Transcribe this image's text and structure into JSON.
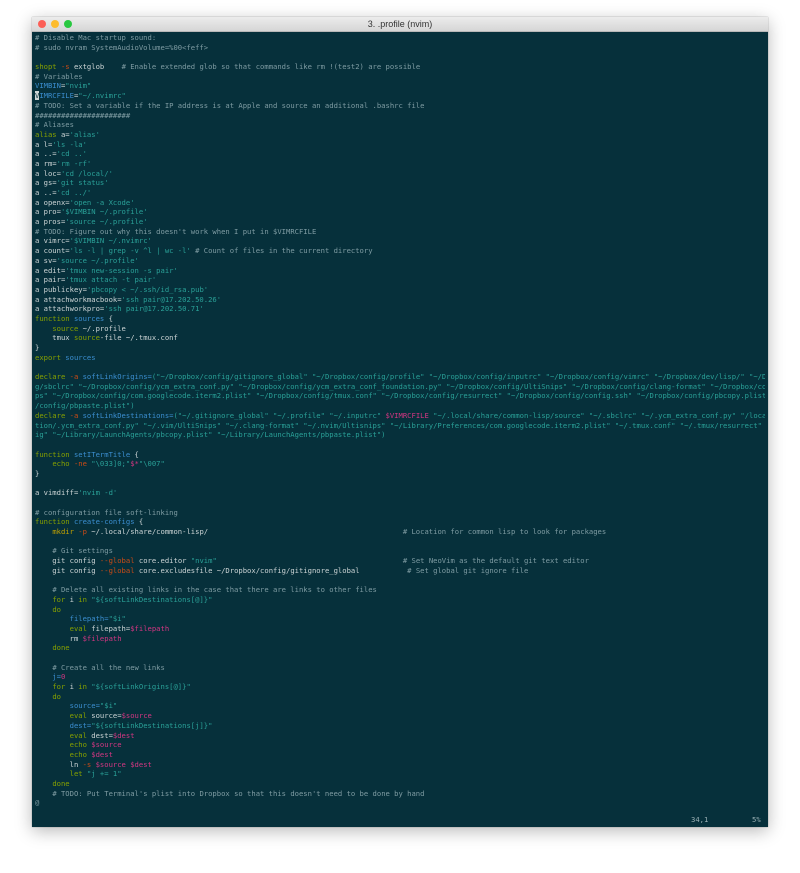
{
  "window": {
    "title": "3. .profile (nvim)"
  },
  "colors": {
    "background": "#06303b",
    "comment": "#7f9ca3",
    "keyword": "#86a000",
    "builtin": "#3b8ed0",
    "string": "#2aa198",
    "variable": "#d33682",
    "command": "#c2a200",
    "orange": "#cb4b16",
    "text": "#cdd5d6"
  },
  "editor": {
    "lines": [
      [
        [
          "# Disable Mac startup sound:",
          "cm"
        ]
      ],
      [
        [
          "# sudo nvram SystemAudioVolume=%00<feff>",
          "cm"
        ]
      ],
      [],
      [
        [
          "shopt",
          "kw"
        ],
        [
          " ",
          "tx"
        ],
        [
          "-s",
          "or"
        ],
        [
          " extglob    ",
          "tx"
        ],
        [
          "# Enable extended glob so that commands like rm !(test2) are possible",
          "cm"
        ]
      ],
      [
        [
          "# Variables",
          "cm"
        ]
      ],
      [
        [
          "VIMBIN",
          "bl"
        ],
        [
          "=",
          "tx"
        ],
        [
          "\"nvim\"",
          "st"
        ]
      ],
      [
        [
          "V",
          "cur"
        ],
        [
          "IMRCFILE",
          "bl"
        ],
        [
          "=",
          "tx"
        ],
        [
          "\"~/.nvimrc\"",
          "st"
        ]
      ],
      [
        [
          "# ",
          "cm"
        ],
        [
          "TODO:",
          "cm"
        ],
        [
          " Set a variable if the IP address is at Apple and source an additional .bashrc file",
          "cm"
        ]
      ],
      [
        [
          "######################",
          "cm"
        ]
      ],
      [
        [
          "# Aliases",
          "cm"
        ]
      ],
      [
        [
          "alias",
          "kw"
        ],
        [
          " a=",
          "tx"
        ],
        [
          "'alias'",
          "st"
        ]
      ],
      [
        [
          "a",
          "tx"
        ],
        [
          " l=",
          "tx"
        ],
        [
          "'ls -la'",
          "st"
        ]
      ],
      [
        [
          "a",
          "tx"
        ],
        [
          " ..=",
          "tx"
        ],
        [
          "'cd ..'",
          "st"
        ]
      ],
      [
        [
          "a",
          "tx"
        ],
        [
          " rm=",
          "tx"
        ],
        [
          "'rm -rf'",
          "st"
        ]
      ],
      [
        [
          "a",
          "tx"
        ],
        [
          " loc=",
          "tx"
        ],
        [
          "'cd /local/'",
          "st"
        ]
      ],
      [
        [
          "a",
          "tx"
        ],
        [
          " gs=",
          "tx"
        ],
        [
          "'git status'",
          "st"
        ]
      ],
      [
        [
          "a",
          "tx"
        ],
        [
          " ..=",
          "tx"
        ],
        [
          "'cd ../'",
          "st"
        ]
      ],
      [
        [
          "a",
          "tx"
        ],
        [
          " openx=",
          "tx"
        ],
        [
          "'open -a Xcode'",
          "st"
        ]
      ],
      [
        [
          "a",
          "tx"
        ],
        [
          " pro=",
          "tx"
        ],
        [
          "'$VIMBIN ~/.profile'",
          "st"
        ]
      ],
      [
        [
          "a",
          "tx"
        ],
        [
          " pros=",
          "tx"
        ],
        [
          "'source ~/.profile'",
          "st"
        ]
      ],
      [
        [
          "# ",
          "cm"
        ],
        [
          "TODO:",
          "cm"
        ],
        [
          " Figure out why this doesn't work when I put in $VIMRCFILE",
          "cm"
        ]
      ],
      [
        [
          "a",
          "tx"
        ],
        [
          " vimrc=",
          "tx"
        ],
        [
          "'$VIMBIN ~/.nvimrc'",
          "st"
        ]
      ],
      [
        [
          "a",
          "tx"
        ],
        [
          " count=",
          "tx"
        ],
        [
          "'ls -l | grep -v ^l | wc -l'",
          "st"
        ],
        [
          " ",
          "tx"
        ],
        [
          "# Count of files in the current directory",
          "cm"
        ]
      ],
      [
        [
          "a",
          "tx"
        ],
        [
          " sv=",
          "tx"
        ],
        [
          "'source ~/.profile'",
          "st"
        ]
      ],
      [
        [
          "a",
          "tx"
        ],
        [
          " edit=",
          "tx"
        ],
        [
          "'tmux new-session -s pair'",
          "st"
        ]
      ],
      [
        [
          "a",
          "tx"
        ],
        [
          " pair=",
          "tx"
        ],
        [
          "'tmux attach -t pair'",
          "st"
        ]
      ],
      [
        [
          "a",
          "tx"
        ],
        [
          " publickey=",
          "tx"
        ],
        [
          "'pbcopy < ~/.ssh/id_rsa.pub'",
          "st"
        ]
      ],
      [
        [
          "a",
          "tx"
        ],
        [
          " attachworkmacbook=",
          "tx"
        ],
        [
          "'ssh pair@17.202.50.26'",
          "st"
        ]
      ],
      [
        [
          "a",
          "tx"
        ],
        [
          " attachworkpro=",
          "tx"
        ],
        [
          "'ssh pair@17.202.50.71'",
          "st"
        ]
      ],
      [
        [
          "function",
          "kw"
        ],
        [
          " ",
          "tx"
        ],
        [
          "sources",
          "bl"
        ],
        [
          " {",
          "tx"
        ]
      ],
      [
        [
          "    ",
          "tx"
        ],
        [
          "source",
          "kw"
        ],
        [
          " ~/.profile",
          "tx"
        ]
      ],
      [
        [
          "    tmux ",
          "tx"
        ],
        [
          "source",
          "kw"
        ],
        [
          "-file ~/.tmux.conf",
          "tx"
        ]
      ],
      [
        [
          "}",
          "tx"
        ]
      ],
      [
        [
          "export",
          "kw"
        ],
        [
          " ",
          "tx"
        ],
        [
          "sources",
          "bl"
        ]
      ],
      [],
      [
        [
          "declare",
          "kw"
        ],
        [
          " ",
          "tx"
        ],
        [
          "-a",
          "or"
        ],
        [
          " softLinkOrigins=",
          "bl"
        ],
        [
          "(\"~/Dropbox/config/gitignore_global\" \"~/Dropbox/config/profile\" \"~/Dropbox/config/inputrc\" \"~/Dropbox/config/vimrc\" \"~/Dropbox/dev/lisp/\" \"~/Dropbox/confi",
          "st"
        ]
      ],
      [
        [
          "g/sbclrc\" \"~/Dropbox/config/ycm_extra_conf.py\" \"~/Dropbox/config/ycm_extra_conf_foundation.py\" \"~/Dropbox/config/UltiSnips\" \"~/Dropbox/config/clang-format\" \"~/Dropbox/config/UltiSnip",
          "st"
        ]
      ],
      [
        [
          "ps\" \"~/Dropbox/config/com.googlecode.iterm2.plist\" \"~/Dropbox/config/tmux.conf\" \"~/Dropbox/config/resurrect\" \"~/Dropbox/config/config.ssh\" \"~/Dropbox/config/pbcopy.plist\" \"~/Dropbox",
          "st"
        ]
      ],
      [
        [
          "/config/pbpaste.plist\")",
          "st"
        ]
      ],
      [
        [
          "declare",
          "kw"
        ],
        [
          " ",
          "tx"
        ],
        [
          "-a",
          "or"
        ],
        [
          " softLinkDestinations=",
          "bl"
        ],
        [
          "(\"~/.gitignore_global\" \"~/.profile\" \"~/.inputrc\" ",
          "st"
        ],
        [
          "$VIMRCFILE",
          "mg"
        ],
        [
          " \"~/.local/share/common-lisp/source\" \"~/.sbclrc\" \"~/.ycm_extra_conf.py\" \"/local/dev/Founda",
          "st"
        ]
      ],
      [
        [
          "tion/.ycm_extra_conf.py\" \"~/.vim/UltiSnips\" \"~/.clang-format\" \"~/.nvim/Ultisnips\" \"~/Library/Preferences/com.googlecode.iterm2.plist\" \"~/.tmux.conf\" \"~/.tmux/resurrect\" \"~/.ssh/conf",
          "st"
        ]
      ],
      [
        [
          "ig\" \"~/Library/LaunchAgents/pbcopy.plist\" \"~/Library/LaunchAgents/pbpaste.plist\")",
          "st"
        ]
      ],
      [],
      [
        [
          "function",
          "kw"
        ],
        [
          " ",
          "tx"
        ],
        [
          "setITermTitle",
          "bl"
        ],
        [
          " {",
          "tx"
        ]
      ],
      [
        [
          "    ",
          "tx"
        ],
        [
          "echo",
          "kw"
        ],
        [
          " ",
          "tx"
        ],
        [
          "-ne",
          "or"
        ],
        [
          " ",
          "tx"
        ],
        [
          "\"\\033]0;\"",
          "st"
        ],
        [
          "$*",
          "mg"
        ],
        [
          "\"\\007\"",
          "st"
        ]
      ],
      [
        [
          "}",
          "tx"
        ]
      ],
      [],
      [
        [
          "a",
          "tx"
        ],
        [
          " vimdiff=",
          "tx"
        ],
        [
          "'nvim -d'",
          "st"
        ]
      ],
      [],
      [
        [
          "# configuration file soft-linking",
          "cm"
        ]
      ],
      [
        [
          "function",
          "kw"
        ],
        [
          " ",
          "tx"
        ],
        [
          "create-configs",
          "bl"
        ],
        [
          " {",
          "tx"
        ]
      ],
      [
        [
          "    ",
          "tx"
        ],
        [
          "mkdir",
          "yl"
        ],
        [
          " ",
          "tx"
        ],
        [
          "-p",
          "or"
        ],
        [
          " ~/.local/share/common-lisp/                                             ",
          "tx"
        ],
        [
          "# Location for common lisp to look for packages",
          "cm"
        ]
      ],
      [],
      [
        [
          "    ",
          "tx"
        ],
        [
          "# Git settings",
          "cm"
        ]
      ],
      [
        [
          "    git config ",
          "tx"
        ],
        [
          "--global",
          "or"
        ],
        [
          " core.editor ",
          "tx"
        ],
        [
          "\"nvim\"",
          "st"
        ],
        [
          "                                           ",
          "tx"
        ],
        [
          "# Set NeoVim as the default git text editor",
          "cm"
        ]
      ],
      [
        [
          "    git config ",
          "tx"
        ],
        [
          "--global",
          "or"
        ],
        [
          " core.excludesfile ~/Dropbox/config/gitignore_global           ",
          "tx"
        ],
        [
          "# Set global git ignore file",
          "cm"
        ]
      ],
      [],
      [
        [
          "    ",
          "tx"
        ],
        [
          "# Delete all existing links in the case that there are links to other files",
          "cm"
        ]
      ],
      [
        [
          "    ",
          "tx"
        ],
        [
          "for",
          "kw"
        ],
        [
          " i ",
          "tx"
        ],
        [
          "in",
          "kw"
        ],
        [
          " ",
          "tx"
        ],
        [
          "\"${softLinkDestinations[@]}\"",
          "st"
        ]
      ],
      [
        [
          "    ",
          "tx"
        ],
        [
          "do",
          "kw"
        ]
      ],
      [
        [
          "        filepath=",
          "bl"
        ],
        [
          "\"$i\"",
          "st"
        ]
      ],
      [
        [
          "        ",
          "tx"
        ],
        [
          "eval",
          "kw"
        ],
        [
          " filepath=",
          "tx"
        ],
        [
          "$filepath",
          "mg"
        ]
      ],
      [
        [
          "        rm ",
          "tx"
        ],
        [
          "$filepath",
          "mg"
        ]
      ],
      [
        [
          "    ",
          "tx"
        ],
        [
          "done",
          "kw"
        ]
      ],
      [],
      [
        [
          "    ",
          "tx"
        ],
        [
          "# Create all the new links",
          "cm"
        ]
      ],
      [
        [
          "    j=",
          "bl"
        ],
        [
          "0",
          "mg"
        ]
      ],
      [
        [
          "    ",
          "tx"
        ],
        [
          "for",
          "kw"
        ],
        [
          " i ",
          "tx"
        ],
        [
          "in",
          "kw"
        ],
        [
          " ",
          "tx"
        ],
        [
          "\"${softLinkOrigins[@]}\"",
          "st"
        ]
      ],
      [
        [
          "    ",
          "tx"
        ],
        [
          "do",
          "kw"
        ]
      ],
      [
        [
          "        source=",
          "bl"
        ],
        [
          "\"$i\"",
          "st"
        ]
      ],
      [
        [
          "        ",
          "tx"
        ],
        [
          "eval",
          "kw"
        ],
        [
          " source=",
          "tx"
        ],
        [
          "$source",
          "mg"
        ]
      ],
      [
        [
          "        dest=",
          "bl"
        ],
        [
          "\"${softLinkDestinations[j]}\"",
          "st"
        ]
      ],
      [
        [
          "        ",
          "tx"
        ],
        [
          "eval",
          "kw"
        ],
        [
          " dest=",
          "tx"
        ],
        [
          "$dest",
          "mg"
        ]
      ],
      [
        [
          "        ",
          "tx"
        ],
        [
          "echo",
          "kw"
        ],
        [
          " ",
          "tx"
        ],
        [
          "$source",
          "mg"
        ]
      ],
      [
        [
          "        ",
          "tx"
        ],
        [
          "echo",
          "kw"
        ],
        [
          " ",
          "tx"
        ],
        [
          "$dest",
          "mg"
        ]
      ],
      [
        [
          "        ln ",
          "tx"
        ],
        [
          "-s",
          "or"
        ],
        [
          " ",
          "tx"
        ],
        [
          "$source",
          "mg"
        ],
        [
          " ",
          "tx"
        ],
        [
          "$dest",
          "mg"
        ]
      ],
      [
        [
          "        ",
          "tx"
        ],
        [
          "let",
          "kw"
        ],
        [
          " ",
          "tx"
        ],
        [
          "\"j += 1\"",
          "st"
        ]
      ],
      [
        [
          "    ",
          "tx"
        ],
        [
          "done",
          "kw"
        ]
      ],
      [
        [
          "    ",
          "tx"
        ],
        [
          "# ",
          "cm"
        ],
        [
          "TODO:",
          "cm"
        ],
        [
          " Put Terminal's plist into Dropbox so that this doesn't need to be done by hand",
          "cm"
        ]
      ],
      [
        [
          "@",
          "cm"
        ]
      ]
    ]
  },
  "status": {
    "position": "34,1",
    "percent": "5%"
  }
}
